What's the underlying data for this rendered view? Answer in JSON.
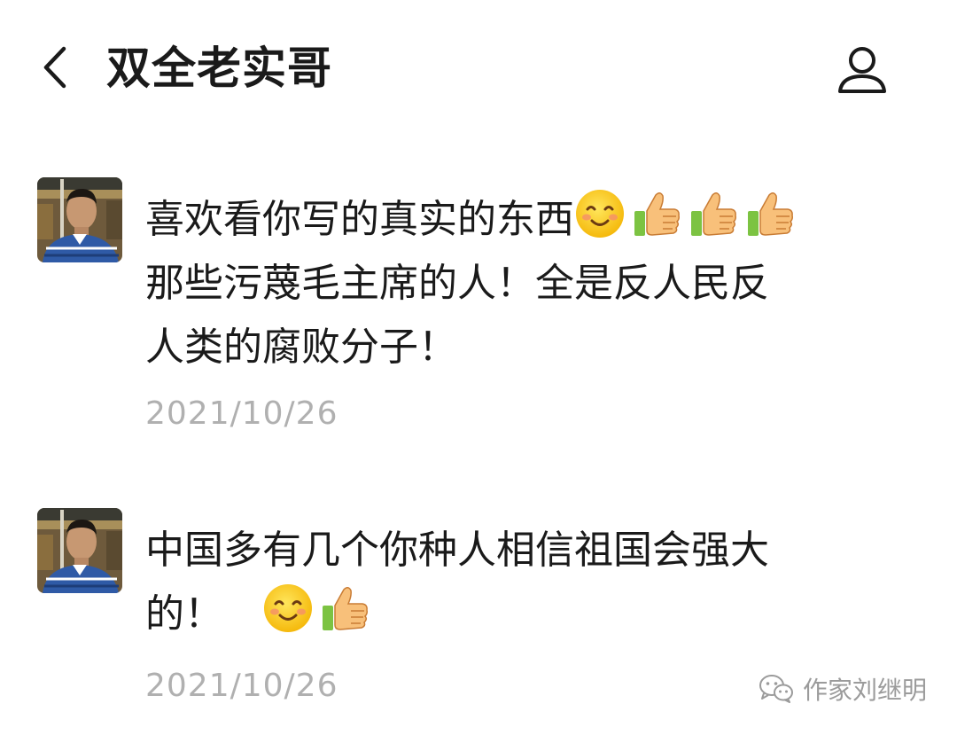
{
  "header": {
    "back_icon": "chevron-left-icon",
    "title": "双全老实哥",
    "profile_icon": "person-icon"
  },
  "comments": [
    {
      "avatar_icon": "user-avatar-photo",
      "lines": [
        "喜欢看你写的真实的东西",
        "那些污蔑毛主席的人！全是反人民反",
        "人类的腐败分子！"
      ],
      "emojis_line1": [
        "smiling-face-emoji",
        "thumbs-up-emoji",
        "thumbs-up-emoji",
        "thumbs-up-emoji"
      ],
      "date": "2021/10/26"
    },
    {
      "avatar_icon": "user-avatar-photo",
      "lines": [
        "中国多有几个你种人相信祖国会强大",
        "的！"
      ],
      "emojis_line2": [
        "smiling-face-emoji",
        "thumbs-up-emoji"
      ],
      "date": "2021/10/26"
    }
  ],
  "watermark": {
    "icon": "wechat-icon",
    "text": "作家刘继明"
  }
}
